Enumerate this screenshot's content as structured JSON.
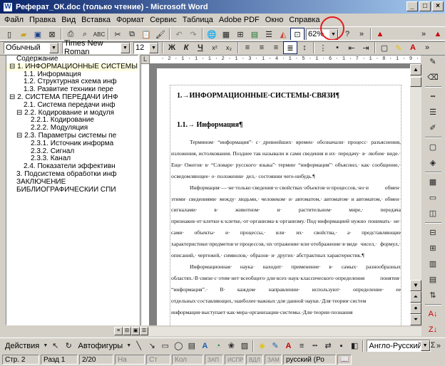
{
  "window": {
    "title": "Реферат_ОК.doc (только чтение) - Microsoft Word",
    "app_icon": "W",
    "buttons": [
      "_",
      "□",
      "×"
    ]
  },
  "menu": [
    "Файл",
    "Правка",
    "Вид",
    "Вставка",
    "Формат",
    "Сервис",
    "Таблица",
    "Adobe PDF",
    "Окно",
    "Справка"
  ],
  "toolbar_standard": {
    "zoom": "62%",
    "icons": [
      "new-document-icon",
      "open-folder-icon",
      "save-icon",
      "permission-icon",
      "print-icon",
      "print-preview-icon",
      "spelling-icon",
      "cut-icon",
      "copy-icon",
      "paste-icon",
      "format-painter-icon",
      "undo-icon",
      "redo-icon",
      "hyperlink-icon",
      "tables-borders-icon",
      "insert-table-icon",
      "insert-excel-icon",
      "columns-icon",
      "drawing-icon",
      "document-map-icon",
      "show-hide-icon",
      "help-icon",
      "pdf-icon"
    ]
  },
  "toolbar_formatting": {
    "style": "Обычный",
    "font": "Times New Roman",
    "size": "12",
    "bold": "Ж",
    "italic": "К",
    "underline": "Ч"
  },
  "document_map": [
    {
      "text": "Содержание",
      "level": 0,
      "selected": true
    },
    {
      "text": "⊟ 1. ИНФОРМАЦИОННЫЕ СИСТЕМЫ СВЯЗИ",
      "level": 0
    },
    {
      "text": "1.1. Информация",
      "level": 2
    },
    {
      "text": "1.2. Структурная схема инф",
      "level": 2
    },
    {
      "text": "1.3. Развитие техники пере",
      "level": 2
    },
    {
      "text": "⊟ 2. СИСТЕМА ПЕРЕДАЧИ ИНФ",
      "level": 0
    },
    {
      "text": "2.1. Система передачи инф",
      "level": 2
    },
    {
      "text": "⊟ 2.2. Кодирование и модуля",
      "level": 1
    },
    {
      "text": "2.2.1. Кодирование",
      "level": 3
    },
    {
      "text": "2.2.2. Модуляция",
      "level": 3
    },
    {
      "text": "⊟ 2.3. Параметры системы пе",
      "level": 1
    },
    {
      "text": "2.3.1. Источник информа",
      "level": 3
    },
    {
      "text": "2.3.2. Сигнал",
      "level": 3
    },
    {
      "text": "2.3.3. Канал",
      "level": 3
    },
    {
      "text": "2.4. Показатели эффективн",
      "level": 2
    },
    {
      "text": "3. Подсистема обработки инф",
      "level": 1
    },
    {
      "text": "ЗАКЛЮЧЕНИЕ",
      "level": 1
    },
    {
      "text": "БИБЛИОГРАФИЧЕСКИЙ СПИ",
      "level": 1
    }
  ],
  "ruler": {
    "marks": "· 2 · 1 · 1 · 1 · 2 · 1 · 3 · 1 · 4 · 1 · 5 · 1 · 6 · 1 · 7 · 1 · 8 · 1 · 9 · 1 ·10· 1 ·11· 1 ·12· 1 ·13· 1 ·14· 1 ·15· 1 ·16· 1 ·17· 1 ·18"
  },
  "document": {
    "heading1": "1.→ИНФОРМАЦИОННЫЕ·СИСТЕМЫ·СВЯЗИ¶",
    "heading2": "1.1.→ Информация¶",
    "paragraphs": [
      "Термином· “информация”· с· древнейших· времен· обозначали· процесс· разъяснения, изложения, истолкования. Позднее так называли и сами сведения и их· передачу· в· любом· виде.· Еще· Ожегов· в· “Словаре· русского· языка”· термин· “информация”· объяснил,· как· сообщение,· осведомляющее· о· положении· дел,· состоянии чего-нибудь.¶",
      "Информация·—·не·только·сведения·о·свойствах·объектов·и·процессов,·но·и обмен· этими· сведениями· между· людьми,· человеком· и· автоматом,· автоматом· и автоматом,· обмен· сигналами· в· животном· и· растительном· мире,· передача признаков·от·клетки·к·клетке,·от·организма·к·организму.·Под·информацией·нужно понимать· не· сами· объекты· и· процессы,· или· их· свойства,· а· представляющие характеристики·предметов·и·процессов,·их·отражение·или·отображение·в·виде чисел,· формул,· описаний,· чертежей,· символов,· образов· и· других· абстрактных характеристик.¶",
      "Информационная· наука· находит· применение· в· самых· разнообразных областях.·В·связи·с·этим·нет·всеобщего·для·всех·наук·классического·определения понятия· “информация”.· В· каждом· направлении· используют· определение· ее отдельных·составляющих,·наиболее·важных·для·данной·науки.·Для·теории·систем информация·выступает·как·мера·организации·системы.·Для·теории·познания"
    ]
  },
  "drawing_toolbar": {
    "actions": "Действия",
    "autoshapes": "Автофигуры",
    "language": "Англо-Русский"
  },
  "status": {
    "page": "Стр.  2",
    "section": "Разд  1",
    "pages": "2/20",
    "at": "На",
    "line": "Ст",
    "col": "Кол",
    "rec": "ЗАП",
    "trk": "ИСПР",
    "ext": "ВДЛ",
    "ovr": "ЗАМ",
    "lang": "русский (Ро"
  }
}
